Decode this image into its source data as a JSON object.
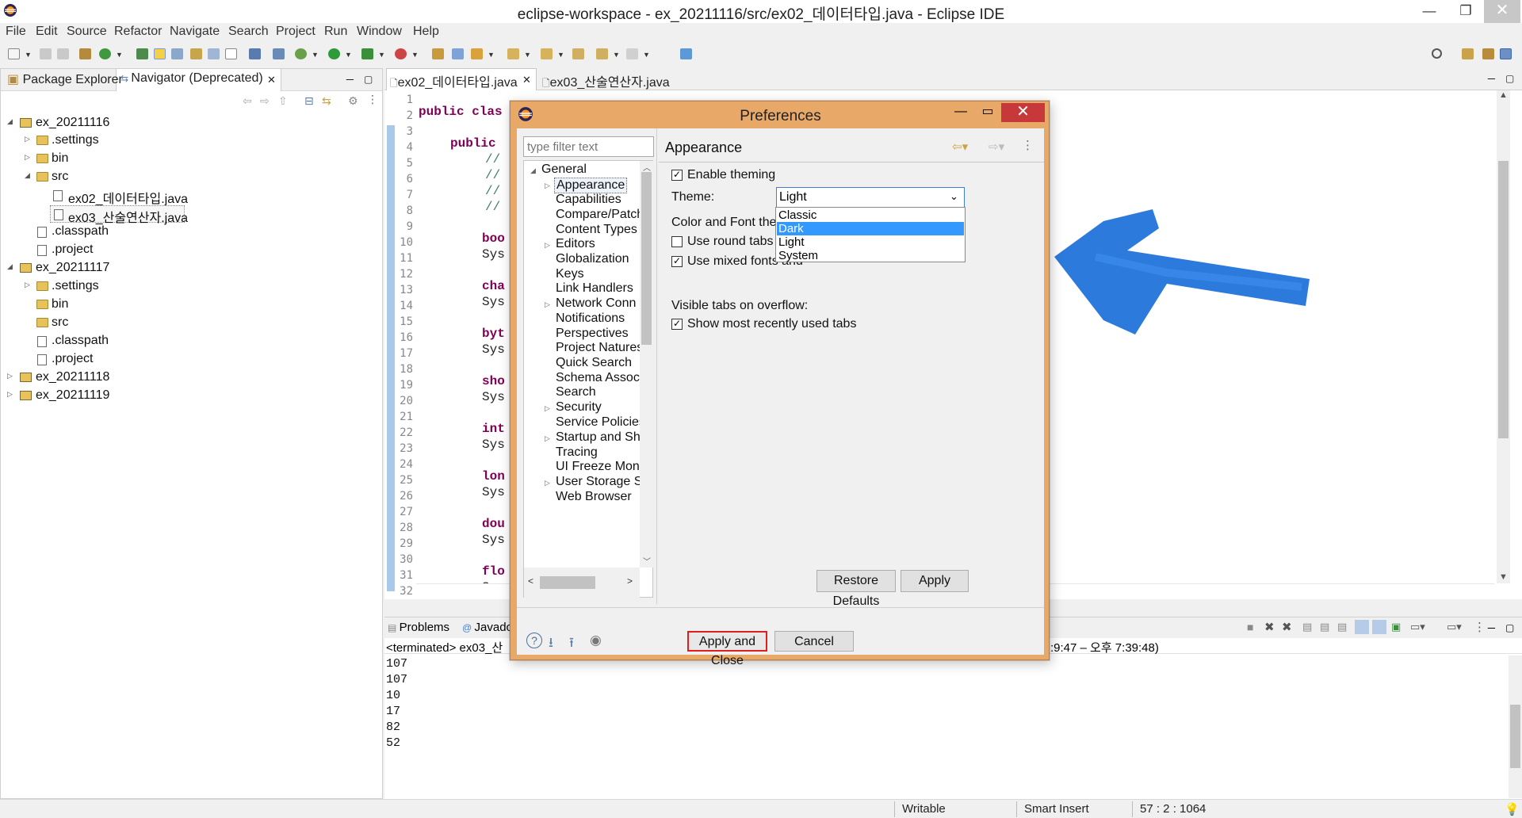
{
  "window": {
    "title": "eclipse-workspace - ex_20211116/src/ex02_데이터타입.java - Eclipse IDE",
    "minimize_glyph": "—",
    "restore_glyph": "❐",
    "close_glyph": "✕"
  },
  "menu": [
    "File",
    "Edit",
    "Source",
    "Refactor",
    "Navigate",
    "Search",
    "Project",
    "Run",
    "Window",
    "Help"
  ],
  "left_panel": {
    "tabs": [
      "Package Explorer",
      "Navigator (Deprecated)"
    ],
    "tree": [
      {
        "label": "ex_20211116",
        "icon": "project-icon",
        "expanded": true
      },
      {
        "label": ".settings",
        "icon": "folder-icon"
      },
      {
        "label": "bin",
        "icon": "folder-icon"
      },
      {
        "label": "src",
        "icon": "folder-icon",
        "expanded": true
      },
      {
        "label": "ex02_데이터타입.java",
        "icon": "java-file-icon"
      },
      {
        "label": "ex03_산술연산자.java",
        "icon": "java-file-icon",
        "selected": true
      },
      {
        "label": ".classpath",
        "icon": "xml-file-icon"
      },
      {
        "label": ".project",
        "icon": "xml-file-icon"
      },
      {
        "label": "ex_20211117",
        "icon": "project-icon",
        "expanded": true
      },
      {
        "label": ".settings",
        "icon": "folder-icon"
      },
      {
        "label": "bin",
        "icon": "folder-icon"
      },
      {
        "label": "src",
        "icon": "folder-icon"
      },
      {
        "label": ".classpath",
        "icon": "xml-file-icon"
      },
      {
        "label": ".project",
        "icon": "xml-file-icon"
      },
      {
        "label": "ex_20211118",
        "icon": "project-icon"
      },
      {
        "label": "ex_20211119",
        "icon": "project-icon"
      }
    ]
  },
  "editor": {
    "tabs": [
      "ex02_데이터타입.java",
      "ex03_산술연산자.java"
    ],
    "line_numbers": [
      "1",
      "2",
      "3",
      "4",
      "5",
      "6",
      "7",
      "8",
      "9",
      "10",
      "11",
      "12",
      "13",
      "14",
      "15",
      "16",
      "17",
      "18",
      "19",
      "20",
      "21",
      "22",
      "23",
      "24",
      "25",
      "26",
      "27",
      "28",
      "29",
      "30",
      "31",
      "32"
    ],
    "code_fragments": {
      "l2": "public clas",
      "l4": "public ",
      "l5": "// ",
      "l6": "// ",
      "l7": "// ",
      "l8": "// ",
      "l10": "boo",
      "l11": "Sys",
      "l13": "cha",
      "l14": "Sys",
      "l16": "byt",
      "l17": "Sys",
      "l19": "sho",
      "l20": "Sys",
      "l22": "int",
      "l23": "Sys",
      "l25": "lon",
      "l26": "Sys",
      "l28": "dou",
      "l29": "Sys",
      "l31": "flo",
      "l32": "Sys"
    }
  },
  "console": {
    "tabs": [
      "Problems",
      "Javado"
    ],
    "header_left": "<terminated> ex03_산",
    "header_right": ":9:47 – 오후 7:39:48)",
    "lines": [
      "107",
      "107",
      "10",
      "17",
      "82",
      "52"
    ]
  },
  "statusbar": {
    "writable": "Writable",
    "insert_mode": "Smart Insert",
    "position": "57 : 2 : 1064"
  },
  "dialog": {
    "title": "Preferences",
    "filter_placeholder": "type filter text",
    "tree": [
      {
        "label": "General",
        "level": 0,
        "expanded": true
      },
      {
        "label": "Appearance",
        "level": 1,
        "has_children": true,
        "selected": true
      },
      {
        "label": "Capabilities",
        "level": 1
      },
      {
        "label": "Compare/Patch",
        "level": 1
      },
      {
        "label": "Content Types",
        "level": 1
      },
      {
        "label": "Editors",
        "level": 1,
        "has_children": true
      },
      {
        "label": "Globalization",
        "level": 1
      },
      {
        "label": "Keys",
        "level": 1
      },
      {
        "label": "Link Handlers",
        "level": 1
      },
      {
        "label": "Network Conn",
        "level": 1,
        "has_children": true
      },
      {
        "label": "Notifications",
        "level": 1
      },
      {
        "label": "Perspectives",
        "level": 1
      },
      {
        "label": "Project Natures",
        "level": 1
      },
      {
        "label": "Quick Search",
        "level": 1
      },
      {
        "label": "Schema Associ",
        "level": 1
      },
      {
        "label": "Search",
        "level": 1
      },
      {
        "label": "Security",
        "level": 1,
        "has_children": true
      },
      {
        "label": "Service Policies",
        "level": 1
      },
      {
        "label": "Startup and Sh",
        "level": 1,
        "has_children": true
      },
      {
        "label": "Tracing",
        "level": 1
      },
      {
        "label": "UI Freeze Mon",
        "level": 1
      },
      {
        "label": "User Storage S",
        "level": 1,
        "has_children": true
      },
      {
        "label": "Web Browser",
        "level": 1
      }
    ],
    "page": {
      "heading": "Appearance",
      "enable_theming": {
        "label": "Enable theming",
        "checked": true
      },
      "theme_label": "Theme:",
      "theme_value": "Light",
      "theme_options": [
        "Classic",
        "Dark",
        "Light",
        "System"
      ],
      "theme_highlighted": "Dark",
      "color_font_label": "Color and Font theme:",
      "round_tabs": {
        "label": "Use round tabs",
        "checked": false
      },
      "mixed_fonts": {
        "label": "Use mixed fonts and",
        "checked": true
      },
      "visible_tabs_label": "Visible tabs on overflow:",
      "recent_tabs": {
        "label": "Show most recently used tabs",
        "checked": true
      }
    },
    "buttons": {
      "restore_defaults": "Restore Defaults",
      "apply": "Apply",
      "apply_and_close": "Apply and Close",
      "cancel": "Cancel"
    }
  },
  "colors": {
    "dialog_frame": "#e8a968",
    "selection": "#3399ff",
    "annotation_arrow": "#1a6fd8",
    "highlight_box": "#e01e1e"
  }
}
